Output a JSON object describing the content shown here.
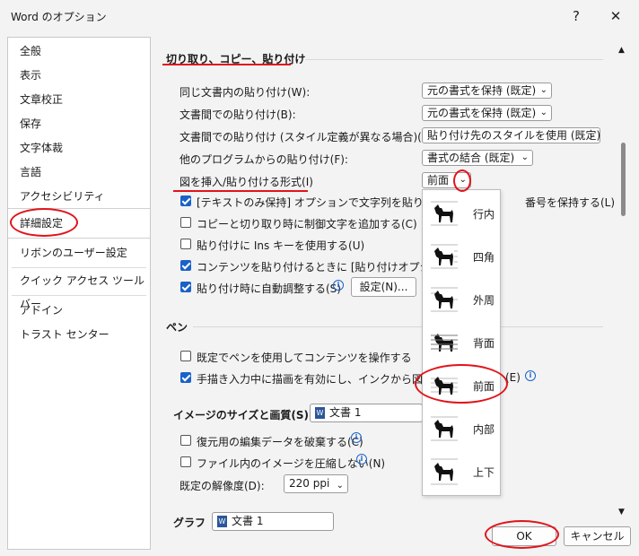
{
  "window": {
    "title": "Word のオプション",
    "help": "?",
    "close": "✕"
  },
  "sidebar": {
    "items": [
      "全般",
      "表示",
      "文章校正",
      "保存",
      "文字体裁",
      "言語",
      "アクセシビリティ",
      "詳細設定",
      "リボンのユーザー設定",
      "クイック アクセス ツール バー",
      "アドイン",
      "トラスト センター"
    ],
    "selected": "詳細設定"
  },
  "cut_copy_paste": {
    "title": "切り取り、コピー、貼り付け",
    "rows": [
      {
        "label": "同じ文書内の貼り付け(W):",
        "value": "元の書式を保持 (既定)"
      },
      {
        "label": "文書間での貼り付け(B):",
        "value": "元の書式を保持 (既定)"
      },
      {
        "label": "文書間での貼り付け (スタイル定義が異なる場合)(E):",
        "value": "貼り付け先のスタイルを使用 (既定)"
      },
      {
        "label": "他のプログラムからの貼り付け(F):",
        "value": "書式の結合 (既定)"
      },
      {
        "label": "図を挿入/貼り付ける形式(I)",
        "value": "前面"
      }
    ],
    "checks": [
      {
        "label": "[テキストのみ保持] オプションで文字列を貼り付けると",
        "tail": "番号を保持する(L)",
        "checked": true
      },
      {
        "label": "コピーと切り取り時に制御文字を追加する(C)",
        "checked": false
      },
      {
        "label": "貼り付けに Ins キーを使用する(U)",
        "checked": false
      },
      {
        "label": "コンテンツを貼り付けるときに [貼り付けオプション] ボタ",
        "checked": true
      },
      {
        "label": "貼り付け時に自動調整する(S)",
        "checked": true
      }
    ],
    "settings_button": "設定(N)..."
  },
  "pen": {
    "title": "ペン",
    "checks": [
      {
        "label": "既定でペンを使用してコンテンツを操作する",
        "checked": false
      },
      {
        "label": "手描き入力中に描画を有効にし、インクから図形への",
        "tail": "(E)",
        "checked": true
      }
    ]
  },
  "image": {
    "title": "イメージのサイズと画質(S)",
    "doc": "文書 1",
    "checks": [
      {
        "label": "復元用の編集データを破棄する(C)",
        "checked": false
      },
      {
        "label": "ファイル内のイメージを圧縮しない(N)",
        "checked": false
      }
    ],
    "resolution_label": "既定の解像度(D):",
    "resolution_value": "220 ppi"
  },
  "chart": {
    "title_partial": "グラフ",
    "doc": "文書 1"
  },
  "popup": {
    "items": [
      "行内",
      "四角",
      "外周",
      "背面",
      "前面",
      "内部",
      "上下"
    ],
    "selected": "前面"
  },
  "buttons": {
    "ok": "OK",
    "cancel": "キャンセル"
  },
  "colors": {
    "accent": "#1a62c9",
    "highlight": "#e0141a"
  }
}
